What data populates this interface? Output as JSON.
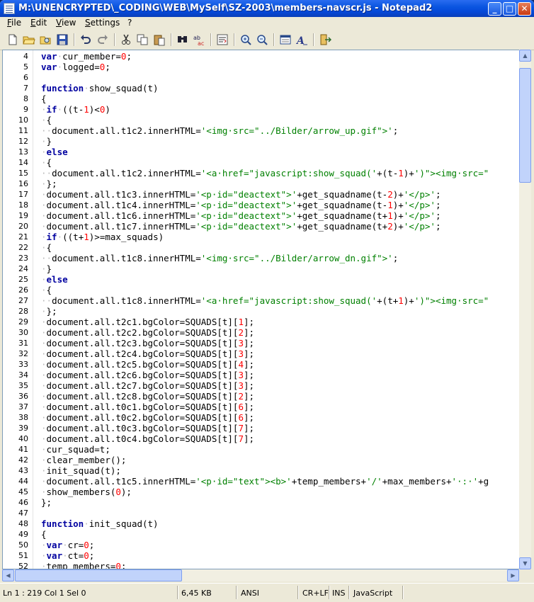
{
  "window": {
    "title": "M:\\UNENCRYPTED\\_CODING\\WEB\\MySelf\\SZ-2003\\members-navscr.js - Notepad2",
    "controls": {
      "minimize": "_",
      "maximize": "□",
      "close": "✕"
    }
  },
  "menu": [
    "File",
    "Edit",
    "View",
    "Settings",
    "?"
  ],
  "toolbar": {
    "icons": [
      "new-file-icon",
      "open-folder-icon",
      "browse-icon",
      "save-icon",
      "undo-icon",
      "redo-icon",
      "cut-icon",
      "copy-icon",
      "paste-icon",
      "find-icon",
      "replace-icon",
      "word-wrap-icon",
      "zoom-in-icon",
      "zoom-out-icon",
      "select-scheme-icon",
      "font-icon",
      "exit-icon"
    ]
  },
  "editor": {
    "lines": [
      {
        "n": "4",
        "tokens": [
          [
            "kw",
            "var"
          ],
          [
            "ws",
            "·"
          ],
          [
            "t",
            "cur_member="
          ],
          [
            "num",
            "0"
          ],
          [
            "t",
            ";"
          ]
        ]
      },
      {
        "n": "5",
        "tokens": [
          [
            "kw",
            "var"
          ],
          [
            "ws",
            "·"
          ],
          [
            "t",
            "logged="
          ],
          [
            "num",
            "0"
          ],
          [
            "t",
            ";"
          ]
        ]
      },
      {
        "n": "6",
        "tokens": []
      },
      {
        "n": "7",
        "tokens": [
          [
            "kw",
            "function"
          ],
          [
            "ws",
            "·"
          ],
          [
            "t",
            "show_squad(t)"
          ]
        ]
      },
      {
        "n": "8",
        "tokens": [
          [
            "t",
            "{"
          ]
        ]
      },
      {
        "n": "9",
        "tokens": [
          [
            "ws",
            "·"
          ],
          [
            "kw",
            "if"
          ],
          [
            "ws",
            "·"
          ],
          [
            "t",
            "((t-"
          ],
          [
            "num",
            "1"
          ],
          [
            "t",
            ")<"
          ],
          [
            "num",
            "0"
          ],
          [
            "t",
            ")"
          ]
        ]
      },
      {
        "n": "10",
        "tokens": [
          [
            "ws",
            "·"
          ],
          [
            "t",
            "{"
          ]
        ]
      },
      {
        "n": "11",
        "tokens": [
          [
            "ws",
            "··"
          ],
          [
            "t",
            "document.all.t1c2.innerHTML="
          ],
          [
            "str",
            "'<img·src=\"../Bilder/arrow_up.gif\">'"
          ],
          [
            "t",
            ";"
          ]
        ]
      },
      {
        "n": "12",
        "tokens": [
          [
            "ws",
            "·"
          ],
          [
            "t",
            "}"
          ]
        ]
      },
      {
        "n": "13",
        "tokens": [
          [
            "ws",
            "·"
          ],
          [
            "kw",
            "else"
          ]
        ]
      },
      {
        "n": "14",
        "tokens": [
          [
            "ws",
            "·"
          ],
          [
            "t",
            "{"
          ]
        ]
      },
      {
        "n": "15",
        "tokens": [
          [
            "ws",
            "··"
          ],
          [
            "t",
            "document.all.t1c2.innerHTML="
          ],
          [
            "str",
            "'<a·href=\"javascript:show_squad('"
          ],
          [
            "t",
            "+(t-"
          ],
          [
            "num",
            "1"
          ],
          [
            "t",
            ")+"
          ],
          [
            "str",
            "')\"><img·src=\""
          ]
        ]
      },
      {
        "n": "16",
        "tokens": [
          [
            "ws",
            "·"
          ],
          [
            "t",
            "};"
          ]
        ]
      },
      {
        "n": "17",
        "tokens": [
          [
            "ws",
            "·"
          ],
          [
            "t",
            "document.all.t1c3.innerHTML="
          ],
          [
            "str",
            "'<p·id=\"deactext\">'"
          ],
          [
            "t",
            "+get_squadname(t-"
          ],
          [
            "num",
            "2"
          ],
          [
            "t",
            ")+"
          ],
          [
            "str",
            "'</p>'"
          ],
          [
            "t",
            ";"
          ]
        ]
      },
      {
        "n": "18",
        "tokens": [
          [
            "ws",
            "·"
          ],
          [
            "t",
            "document.all.t1c4.innerHTML="
          ],
          [
            "str",
            "'<p·id=\"deactext\">'"
          ],
          [
            "t",
            "+get_squadname(t-"
          ],
          [
            "num",
            "1"
          ],
          [
            "t",
            ")+"
          ],
          [
            "str",
            "'</p>'"
          ],
          [
            "t",
            ";"
          ]
        ]
      },
      {
        "n": "19",
        "tokens": [
          [
            "ws",
            "·"
          ],
          [
            "t",
            "document.all.t1c6.innerHTML="
          ],
          [
            "str",
            "'<p·id=\"deactext\">'"
          ],
          [
            "t",
            "+get_squadname(t+"
          ],
          [
            "num",
            "1"
          ],
          [
            "t",
            ")+"
          ],
          [
            "str",
            "'</p>'"
          ],
          [
            "t",
            ";"
          ]
        ]
      },
      {
        "n": "20",
        "tokens": [
          [
            "ws",
            "·"
          ],
          [
            "t",
            "document.all.t1c7.innerHTML="
          ],
          [
            "str",
            "'<p·id=\"deactext\">'"
          ],
          [
            "t",
            "+get_squadname(t+"
          ],
          [
            "num",
            "2"
          ],
          [
            "t",
            ")+"
          ],
          [
            "str",
            "'</p>'"
          ],
          [
            "t",
            ";"
          ]
        ]
      },
      {
        "n": "21",
        "tokens": [
          [
            "ws",
            "·"
          ],
          [
            "kw",
            "if"
          ],
          [
            "ws",
            "·"
          ],
          [
            "t",
            "((t+"
          ],
          [
            "num",
            "1"
          ],
          [
            "t",
            ")>=max_squads)"
          ]
        ]
      },
      {
        "n": "22",
        "tokens": [
          [
            "ws",
            "·"
          ],
          [
            "t",
            "{"
          ]
        ]
      },
      {
        "n": "23",
        "tokens": [
          [
            "ws",
            "··"
          ],
          [
            "t",
            "document.all.t1c8.innerHTML="
          ],
          [
            "str",
            "'<img·src=\"../Bilder/arrow_dn.gif\">'"
          ],
          [
            "t",
            ";"
          ]
        ]
      },
      {
        "n": "24",
        "tokens": [
          [
            "ws",
            "·"
          ],
          [
            "t",
            "}"
          ]
        ]
      },
      {
        "n": "25",
        "tokens": [
          [
            "ws",
            "·"
          ],
          [
            "kw",
            "else"
          ]
        ]
      },
      {
        "n": "26",
        "tokens": [
          [
            "ws",
            "·"
          ],
          [
            "t",
            "{"
          ]
        ]
      },
      {
        "n": "27",
        "tokens": [
          [
            "ws",
            "··"
          ],
          [
            "t",
            "document.all.t1c8.innerHTML="
          ],
          [
            "str",
            "'<a·href=\"javascript:show_squad('"
          ],
          [
            "t",
            "+(t+"
          ],
          [
            "num",
            "1"
          ],
          [
            "t",
            ")+"
          ],
          [
            "str",
            "')\"><img·src=\""
          ]
        ]
      },
      {
        "n": "28",
        "tokens": [
          [
            "ws",
            "·"
          ],
          [
            "t",
            "};"
          ]
        ]
      },
      {
        "n": "29",
        "tokens": [
          [
            "ws",
            "·"
          ],
          [
            "t",
            "document.all.t2c1.bgColor=SQUADS[t]["
          ],
          [
            "num",
            "1"
          ],
          [
            "t",
            "];"
          ]
        ]
      },
      {
        "n": "30",
        "tokens": [
          [
            "ws",
            "·"
          ],
          [
            "t",
            "document.all.t2c2.bgColor=SQUADS[t]["
          ],
          [
            "num",
            "2"
          ],
          [
            "t",
            "];"
          ]
        ]
      },
      {
        "n": "31",
        "tokens": [
          [
            "ws",
            "·"
          ],
          [
            "t",
            "document.all.t2c3.bgColor=SQUADS[t]["
          ],
          [
            "num",
            "3"
          ],
          [
            "t",
            "];"
          ]
        ]
      },
      {
        "n": "32",
        "tokens": [
          [
            "ws",
            "·"
          ],
          [
            "t",
            "document.all.t2c4.bgColor=SQUADS[t]["
          ],
          [
            "num",
            "3"
          ],
          [
            "t",
            "];"
          ]
        ]
      },
      {
        "n": "33",
        "tokens": [
          [
            "ws",
            "·"
          ],
          [
            "t",
            "document.all.t2c5.bgColor=SQUADS[t]["
          ],
          [
            "num",
            "4"
          ],
          [
            "t",
            "];"
          ]
        ]
      },
      {
        "n": "34",
        "tokens": [
          [
            "ws",
            "·"
          ],
          [
            "t",
            "document.all.t2c6.bgColor=SQUADS[t]["
          ],
          [
            "num",
            "3"
          ],
          [
            "t",
            "];"
          ]
        ]
      },
      {
        "n": "35",
        "tokens": [
          [
            "ws",
            "·"
          ],
          [
            "t",
            "document.all.t2c7.bgColor=SQUADS[t]["
          ],
          [
            "num",
            "3"
          ],
          [
            "t",
            "];"
          ]
        ]
      },
      {
        "n": "36",
        "tokens": [
          [
            "ws",
            "·"
          ],
          [
            "t",
            "document.all.t2c8.bgColor=SQUADS[t]["
          ],
          [
            "num",
            "2"
          ],
          [
            "t",
            "];"
          ]
        ]
      },
      {
        "n": "37",
        "tokens": [
          [
            "ws",
            "·"
          ],
          [
            "t",
            "document.all.t0c1.bgColor=SQUADS[t]["
          ],
          [
            "num",
            "6"
          ],
          [
            "t",
            "];"
          ]
        ]
      },
      {
        "n": "38",
        "tokens": [
          [
            "ws",
            "·"
          ],
          [
            "t",
            "document.all.t0c2.bgColor=SQUADS[t]["
          ],
          [
            "num",
            "6"
          ],
          [
            "t",
            "];"
          ]
        ]
      },
      {
        "n": "39",
        "tokens": [
          [
            "ws",
            "·"
          ],
          [
            "t",
            "document.all.t0c3.bgColor=SQUADS[t]["
          ],
          [
            "num",
            "7"
          ],
          [
            "t",
            "];"
          ]
        ]
      },
      {
        "n": "40",
        "tokens": [
          [
            "ws",
            "·"
          ],
          [
            "t",
            "document.all.t0c4.bgColor=SQUADS[t]["
          ],
          [
            "num",
            "7"
          ],
          [
            "t",
            "];"
          ]
        ]
      },
      {
        "n": "41",
        "tokens": [
          [
            "ws",
            "·"
          ],
          [
            "t",
            "cur_squad=t;"
          ]
        ]
      },
      {
        "n": "42",
        "tokens": [
          [
            "ws",
            "·"
          ],
          [
            "t",
            "clear_member();"
          ]
        ]
      },
      {
        "n": "43",
        "tokens": [
          [
            "ws",
            "·"
          ],
          [
            "t",
            "init_squad(t);"
          ]
        ]
      },
      {
        "n": "44",
        "tokens": [
          [
            "ws",
            "·"
          ],
          [
            "t",
            "document.all.t1c5.innerHTML="
          ],
          [
            "str",
            "'<p·id=\"text\"><b>'"
          ],
          [
            "t",
            "+temp_members+"
          ],
          [
            "str",
            "'/'"
          ],
          [
            "t",
            "+max_members+"
          ],
          [
            "str",
            "'·:·'"
          ],
          [
            "t",
            "+g"
          ]
        ]
      },
      {
        "n": "45",
        "tokens": [
          [
            "ws",
            "·"
          ],
          [
            "t",
            "show_members("
          ],
          [
            "num",
            "0"
          ],
          [
            "t",
            ");"
          ]
        ]
      },
      {
        "n": "46",
        "tokens": [
          [
            "t",
            "};"
          ]
        ]
      },
      {
        "n": "47",
        "tokens": []
      },
      {
        "n": "48",
        "tokens": [
          [
            "kw",
            "function"
          ],
          [
            "ws",
            "·"
          ],
          [
            "t",
            "init_squad(t)"
          ]
        ]
      },
      {
        "n": "49",
        "tokens": [
          [
            "t",
            "{"
          ]
        ]
      },
      {
        "n": "50",
        "tokens": [
          [
            "ws",
            "·"
          ],
          [
            "kw",
            "var"
          ],
          [
            "ws",
            "·"
          ],
          [
            "t",
            "cr="
          ],
          [
            "num",
            "0"
          ],
          [
            "t",
            ";"
          ]
        ]
      },
      {
        "n": "51",
        "tokens": [
          [
            "ws",
            "·"
          ],
          [
            "kw",
            "var"
          ],
          [
            "ws",
            "·"
          ],
          [
            "t",
            "ct="
          ],
          [
            "num",
            "0"
          ],
          [
            "t",
            ";"
          ]
        ]
      },
      {
        "n": "52",
        "tokens": [
          [
            "ws",
            "·"
          ],
          [
            "t",
            "temp_members="
          ],
          [
            "num",
            "0"
          ],
          [
            "t",
            ";"
          ]
        ]
      }
    ]
  },
  "status": {
    "position": "Ln 1 : 219   Col 1   Sel 0",
    "size": "6,45 KB",
    "encoding": "ANSI",
    "line_endings": "CR+LF",
    "mode": "INS",
    "lexer": "JavaScript"
  }
}
